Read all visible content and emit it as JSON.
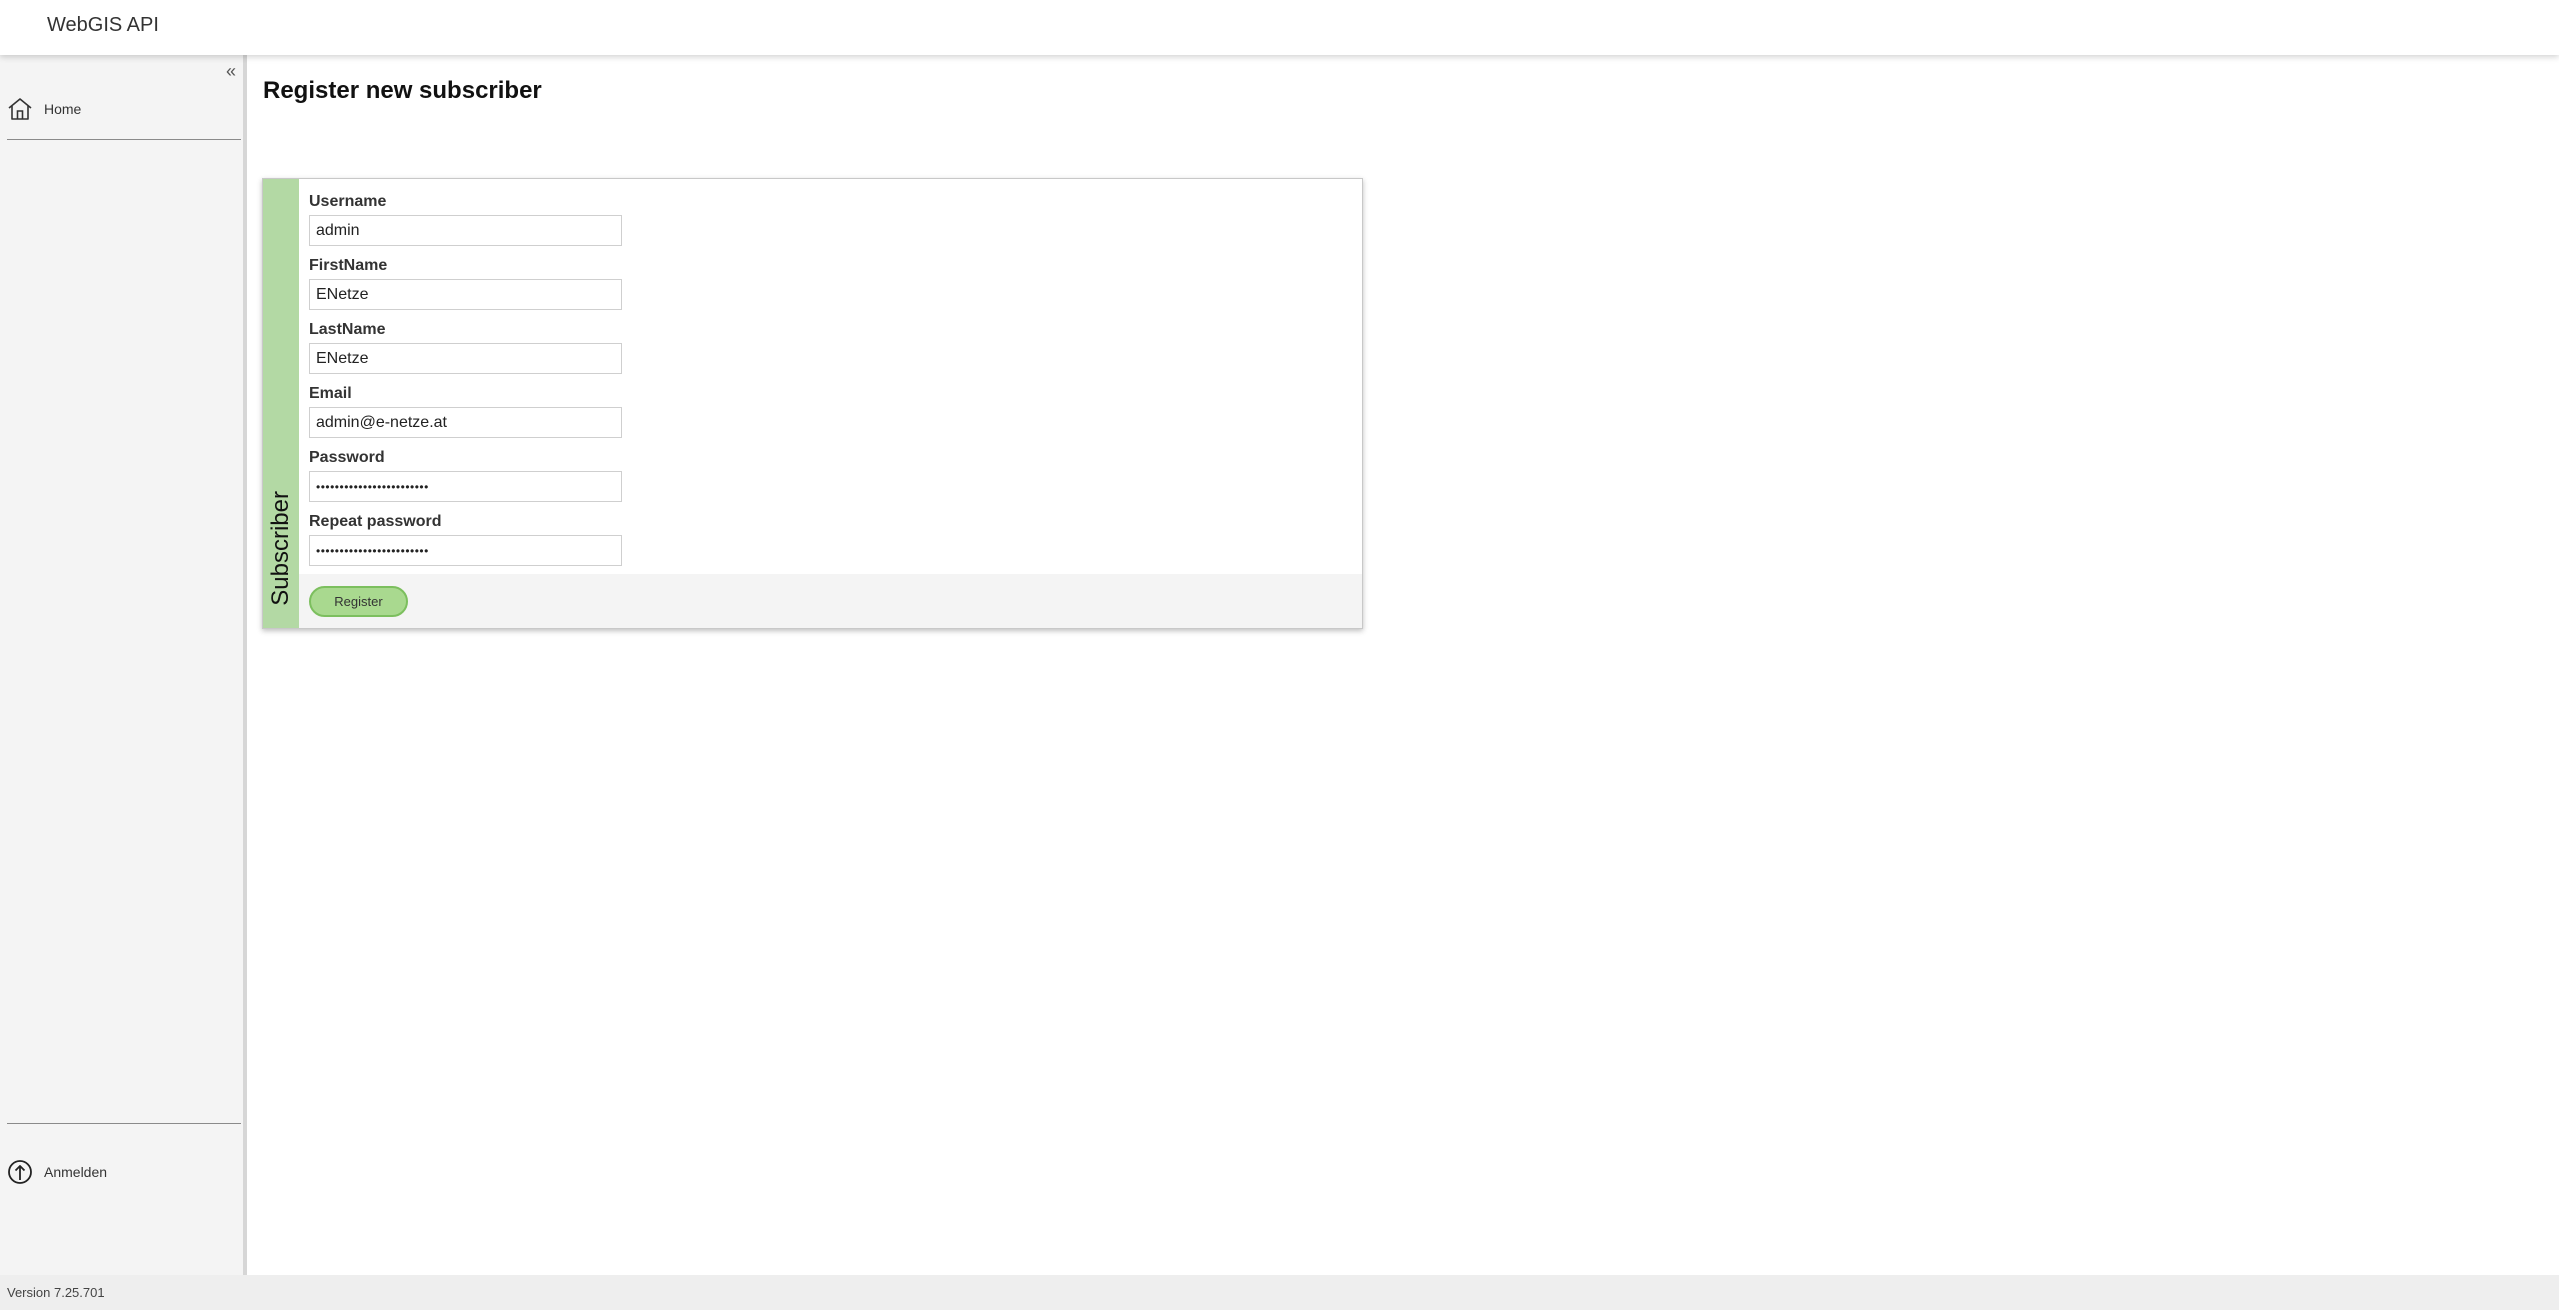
{
  "header": {
    "title": "WebGIS API"
  },
  "sidebar": {
    "collapse_glyph": "«",
    "items": [
      {
        "label": "Home",
        "icon": "home-icon"
      }
    ],
    "bottom_items": [
      {
        "label": "Anmelden",
        "icon": "login-icon"
      }
    ]
  },
  "page": {
    "title": "Register new subscriber"
  },
  "form": {
    "section_label": "Subscriber",
    "fields": [
      {
        "label": "Username",
        "value": "admin"
      },
      {
        "label": "FirstName",
        "value": "ENetze"
      },
      {
        "label": "LastName",
        "value": "ENetze"
      },
      {
        "label": "Email",
        "value": "admin@e-netze.at"
      },
      {
        "label": "Password",
        "value": "••••••••••••••••••••••••"
      },
      {
        "label": "Repeat password",
        "value": "••••••••••••••••••••••••"
      }
    ],
    "submit_label": "Register"
  },
  "footer": {
    "version": "Version 7.25.701"
  },
  "colors": {
    "accent_green": "#b3d9a4",
    "button_green": "#a9d98f",
    "button_border": "#7cbf5e"
  }
}
